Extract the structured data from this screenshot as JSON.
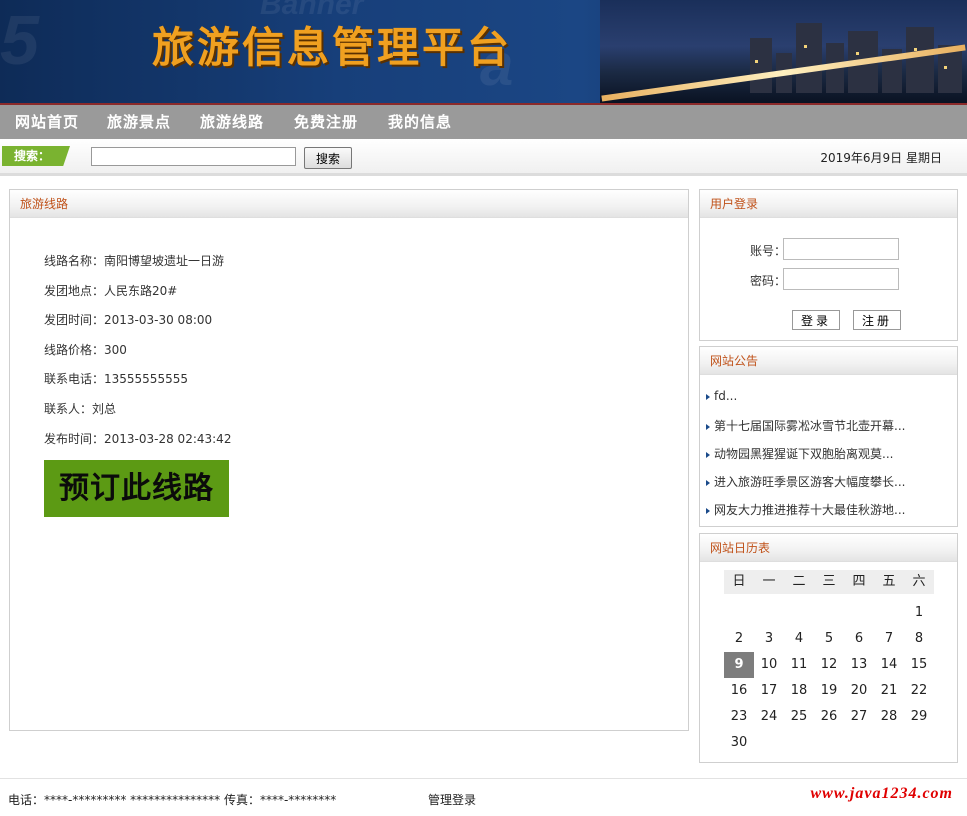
{
  "header": {
    "title": "旅游信息管理平台"
  },
  "nav": {
    "items": [
      {
        "label": "网站首页"
      },
      {
        "label": "旅游景点"
      },
      {
        "label": "旅游线路"
      },
      {
        "label": "免费注册"
      },
      {
        "label": "我的信息"
      }
    ]
  },
  "search": {
    "label": "搜索：",
    "value": "",
    "button": "搜索"
  },
  "date": "2019年6月9日 星期日",
  "main": {
    "title": "旅游线路",
    "details": [
      "线路名称：南阳博望坡遗址一日游",
      "发团地点：人民东路20#",
      "发团时间：2013-03-30 08:00",
      "线路价格：300",
      "联系电话：13555555555",
      "联系人：刘总",
      "发布时间：2013-03-28 02:43:42"
    ],
    "book_button": "预订此线路"
  },
  "login": {
    "title": "用户登录",
    "account_label": "账号：",
    "password_label": "密码：",
    "login_button": "登录",
    "register_button": "注册"
  },
  "notice": {
    "title": "网站公告",
    "items": [
      "fd...",
      "第十七届国际雾凇冰雪节北壶开幕...",
      "动物园黑猩猩诞下双胞胎离观莫...",
      "进入旅游旺季景区游客大幅度攀长...",
      "网友大力推进推荐十大最佳秋游地..."
    ]
  },
  "calendar": {
    "title": "网站日历表",
    "weekdays": [
      "日",
      "一",
      "二",
      "三",
      "四",
      "五",
      "六"
    ],
    "first_weekday": 6,
    "days_in_month": 30,
    "today": 9
  },
  "footer": {
    "contact": "电话：****-********* *************** 传真：****-********",
    "admin_link": "管理登录",
    "watermark": "www.java1234.com"
  },
  "colors": {
    "nav_bg": "#9a9a9a",
    "accent_green": "#7ab330",
    "book_button": "#5c9a14",
    "panel_title": "#c0521a",
    "banner_title": "#f0a020"
  }
}
